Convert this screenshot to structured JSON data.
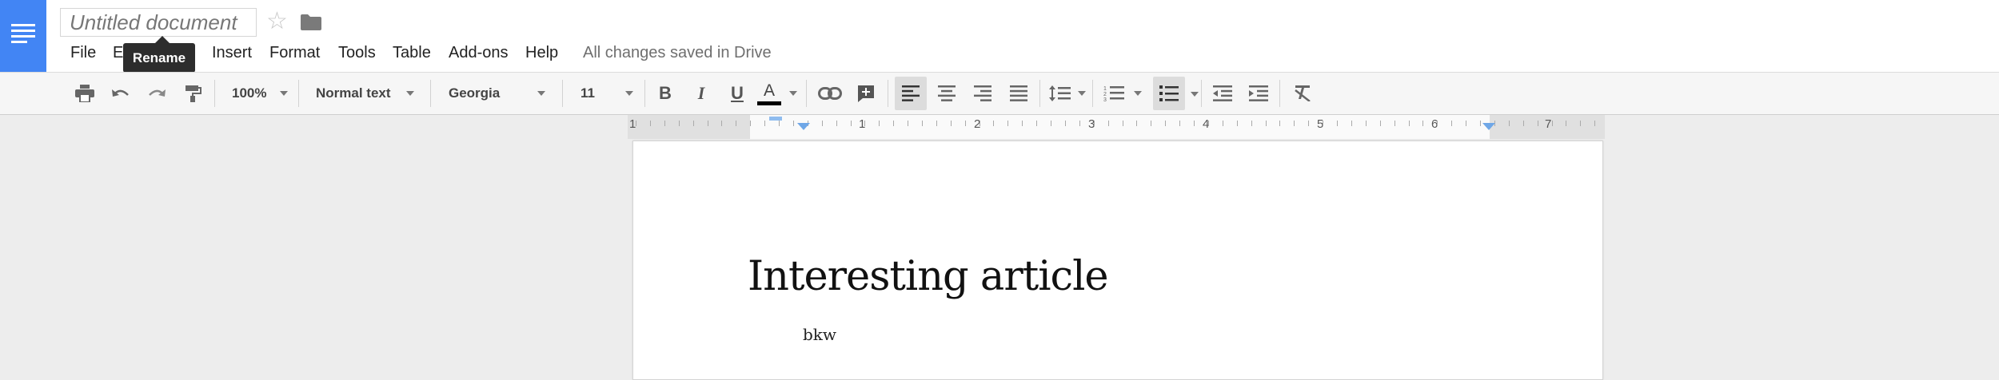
{
  "document": {
    "title_placeholder": "Untitled document",
    "heading": "Interesting article",
    "body_snippet": "bkw"
  },
  "menu": {
    "items": [
      "File",
      "E",
      "Insert",
      "Format",
      "Tools",
      "Table",
      "Add-ons",
      "Help"
    ],
    "save_status": "All changes saved in Drive"
  },
  "tooltip": {
    "label": "Rename"
  },
  "toolbar": {
    "zoom": "100%",
    "style": "Normal text",
    "font": "Georgia",
    "size": "11",
    "bold": "B",
    "italic": "I",
    "underline": "U",
    "text_color": "A"
  },
  "ruler": {
    "numbers": [
      "1",
      "1",
      "2",
      "3",
      "4",
      "5",
      "6",
      "7"
    ]
  },
  "colors": {
    "brand": "#4285f4",
    "ruler_marker": "#6fa7e7",
    "header_bg": "#ffffff",
    "toolbar_bg": "#f6f6f6",
    "canvas_bg": "#ededed"
  },
  "icons": {
    "logo": "docs-logo-icon",
    "star": "star-icon",
    "folder": "folder-icon",
    "print": "print-icon",
    "undo": "undo-icon",
    "redo": "redo-icon",
    "paint_format": "paint-format-icon",
    "link": "link-icon",
    "comment": "add-comment-icon",
    "align_left": "align-left-icon",
    "align_center": "align-center-icon",
    "align_right": "align-right-icon",
    "justify": "justify-icon",
    "line_spacing": "line-spacing-icon",
    "numbered_list": "numbered-list-icon",
    "bulleted_list": "bulleted-list-icon",
    "decrease_indent": "decrease-indent-icon",
    "increase_indent": "increase-indent-icon",
    "clear_formatting": "clear-formatting-icon"
  }
}
